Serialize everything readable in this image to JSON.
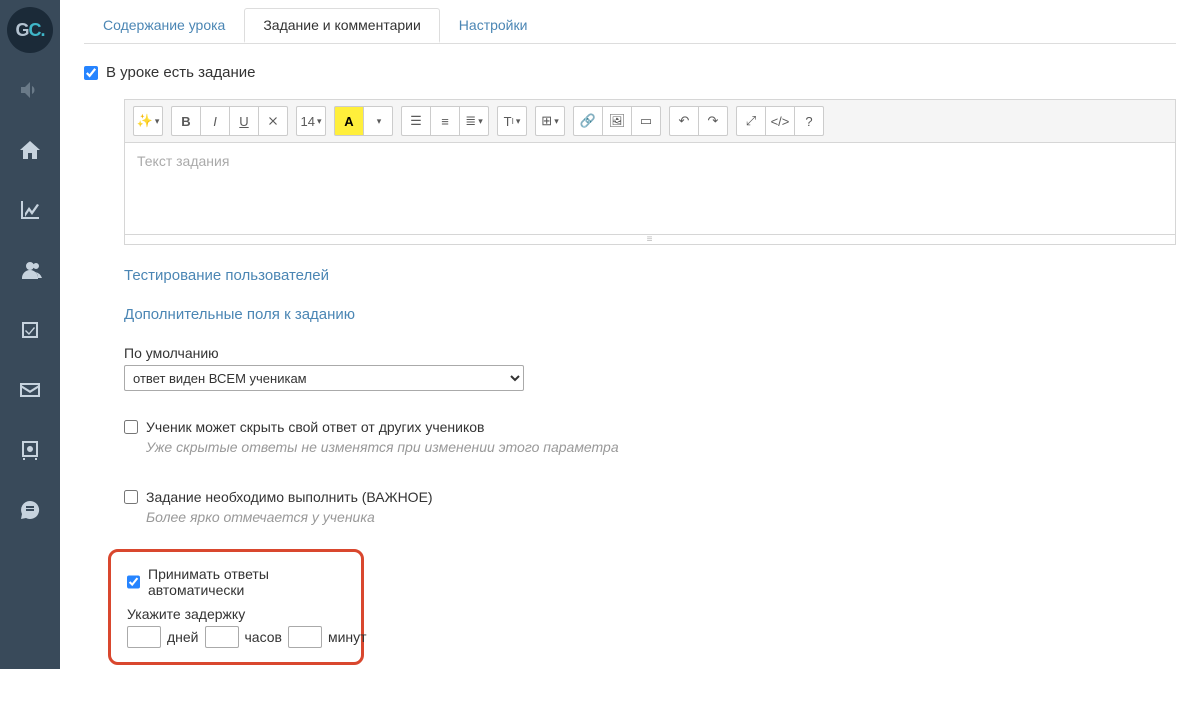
{
  "tabs": {
    "content": "Содержание урока",
    "assignment": "Задание и комментарии",
    "settings": "Настройки"
  },
  "lessonHasAssignment": {
    "label": "В уроке есть задание",
    "checked": true
  },
  "editor": {
    "placeholder": "Текст задания",
    "fontSize": "14"
  },
  "toolbar": {
    "bold": "B",
    "italic": "I",
    "underline": "U"
  },
  "links": {
    "testing": "Тестирование пользователей",
    "extraFields": "Дополнительные поля к заданию"
  },
  "defaultLabel": "По умолчанию",
  "visibilitySelect": {
    "value": "ответ виден ВСЕМ ученикам"
  },
  "hideAnswer": {
    "label": "Ученик может скрыть свой ответ от других учеников",
    "desc": "Уже скрытые ответы не изменятся при изменении этого параметра",
    "checked": false
  },
  "important": {
    "label": "Задание необходимо выполнить (ВАЖНОЕ)",
    "desc": "Более ярко отмечается у ученика",
    "checked": false
  },
  "autoAccept": {
    "label": "Принимать ответы автоматически",
    "checked": true,
    "delayLabel": "Укажите задержку",
    "units": {
      "days": "дней",
      "hours": "часов",
      "minutes": "минут"
    }
  }
}
